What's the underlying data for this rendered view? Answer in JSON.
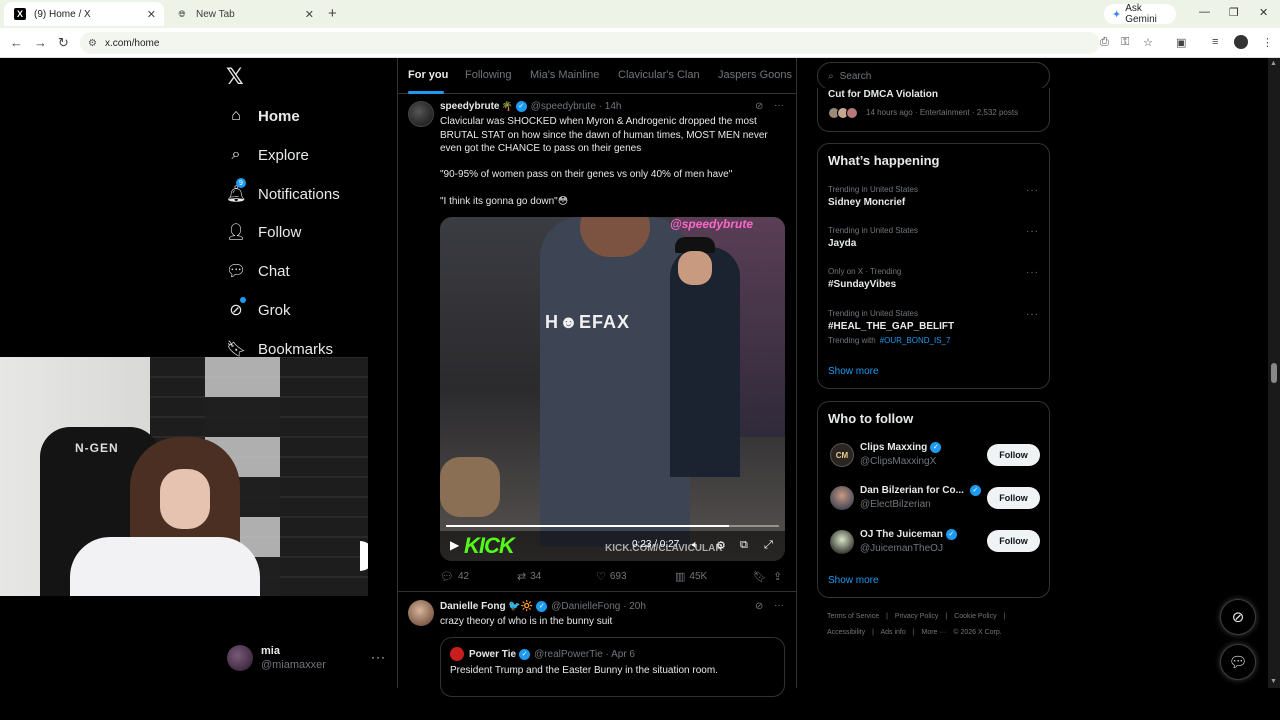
{
  "browser": {
    "tabs": [
      {
        "title": "(9) Home / X",
        "active": true
      },
      {
        "title": "New Tab",
        "active": false
      }
    ],
    "new_tab": "+",
    "gemini_label": "Ask Gemini",
    "url": "x.com/home"
  },
  "nav": {
    "items": [
      {
        "label": "Home",
        "icon": "home-icon",
        "glyph": "⌂"
      },
      {
        "label": "Explore",
        "icon": "search-icon",
        "glyph": "⌕"
      },
      {
        "label": "Notifications",
        "icon": "bell-icon",
        "glyph": "🔔︎",
        "badge": "9"
      },
      {
        "label": "Follow",
        "icon": "person-add-icon",
        "glyph": "👤︎"
      },
      {
        "label": "Chat",
        "icon": "chat-icon",
        "glyph": "💬︎"
      },
      {
        "label": "Grok",
        "icon": "grok-icon",
        "glyph": "⊘"
      },
      {
        "label": "Bookmarks",
        "icon": "bookmark-icon",
        "glyph": "🔖︎"
      }
    ],
    "logo": "𝕏"
  },
  "me": {
    "name": "mia",
    "handle": "@miamaxxer",
    "more": "···"
  },
  "feed": {
    "tabs": [
      "For you",
      "Following",
      "Mia's Mainline",
      "Clavicular's Clan",
      "Jaspers Goons"
    ],
    "post1": {
      "name": "speedybrute",
      "name_emoji": "🌴",
      "handle_time": "@speedybrute · 14h",
      "lines": [
        "Clavicular was SHOCKED when Myron & Androgenic dropped the most",
        "BRUTAL STAT on how since the dawn of human times, MOST MEN never",
        "even got the CHANCE to pass on their genes"
      ],
      "quote1": "\"90-95% of women pass on their genes vs only 40% of men have\"",
      "quote2": "\"I think its gonna go down\"😳",
      "video": {
        "watermark": "@speedybrute",
        "shirt_logo": "H☻EFAX",
        "time": "0:23 / 0:27",
        "progress": 0.85,
        "kick": "KICK",
        "kick_url": "KICK.COM/CLAVICULAR"
      },
      "stats": {
        "replies": "42",
        "reposts": "34",
        "likes": "693",
        "views": "45K"
      }
    },
    "post2": {
      "name": "Danielle Fong 🐦🔆",
      "handle_time": "@DanielleFong · 20h",
      "text": "crazy theory of who is in the bunny suit",
      "quote": {
        "name": "Power Tie",
        "handle_time": "@realPowerTie · Apr 6",
        "text": "President Trump and the Easter Bunny in the situation room."
      }
    }
  },
  "right": {
    "search_placeholder": "Search",
    "dmca": {
      "title": "Cut for DMCA Violation",
      "meta": "14 hours ago · Entertainment · 2,532 posts"
    },
    "happening_title": "What’s happening",
    "trends": [
      {
        "context": "Trending in United States",
        "name": "Sidney Moncrief"
      },
      {
        "context": "Trending in United States",
        "name": "Jayda"
      },
      {
        "context": "Only on X · Trending",
        "name": "#SundayVibes"
      },
      {
        "context": "Trending in United States",
        "name": "#HEAL_THE_GAP_BELIFT",
        "with_label": "Trending with",
        "with_tag": "#OUR_BOND_IS_7"
      }
    ],
    "show_more": "Show more",
    "wtf_title": "Who to follow",
    "wtf": [
      {
        "name": "Clips Maxxing",
        "handle": "@ClipsMaxxingX",
        "avatar_text": "CM",
        "button": "Follow"
      },
      {
        "name": "Dan Bilzerian for Co...",
        "handle": "@ElectBilzerian",
        "avatar_text": "",
        "button": "Follow"
      },
      {
        "name": "OJ The Juiceman",
        "handle": "@JuicemanTheOJ",
        "avatar_text": "",
        "button": "Follow"
      }
    ],
    "footer_row1": [
      "Terms of Service",
      "|",
      "Privacy Policy",
      "|",
      "Cookie Policy",
      "|"
    ],
    "footer_row2": [
      "Accessibility",
      "|",
      "Ads info",
      "|",
      "More ···",
      "© 2026 X Corp."
    ]
  },
  "webcam": {
    "chair_logo": "N-GEN"
  },
  "colors": {
    "accent": "#1d9bf0",
    "bg": "#000000",
    "muted": "#71767b",
    "kick": "#53fc18"
  }
}
